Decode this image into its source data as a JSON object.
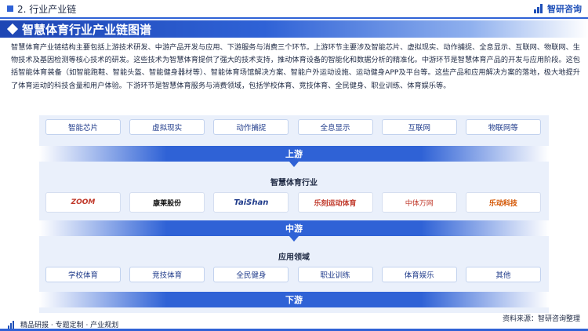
{
  "header": {
    "section_title": "2. 行业产业链",
    "brand_name": "智研咨询"
  },
  "banner": {
    "title": "智慧体育行业产业链图谱"
  },
  "intro": {
    "text": "智慧体育产业链结构主要包括上游技术研发、中游产品开发与应用、下游服务与消费三个环节。上游环节主要涉及智能芯片、虚拟现实、动作捕捉、全息显示、互联网、物联网、生物技术及基因检测等核心技术的研发。这些技术为智慧体育提供了强大的技术支持，推动体育设备的智能化和数据分析的精准化。中游环节是智慧体育产品的开发与应用阶段。这包括智能体育装备（如智能跑鞋、智能头盔、智能健身器材等）、智能体育场馆解决方案、智能户外运动设施、运动健身APP及平台等。这些产品和应用解决方案的落地，极大地提升了体育运动的科技含量和用户体验。下游环节是智慧体育服务与消费领域，包括学校体育、竞技体育、全民健身、职业训练、体育娱乐等。"
  },
  "upstream": {
    "items": [
      "智能芯片",
      "虚拟现实",
      "动作捕捉",
      "全息显示",
      "互联网",
      "物联网等"
    ],
    "bar_label": "上游"
  },
  "midstream": {
    "heading": "智慧体育行业",
    "logos": [
      {
        "name": "ZOOM",
        "color": "#c0392b"
      },
      {
        "name": "康莱股份",
        "color": "#111111"
      },
      {
        "name": "TaiShan",
        "color": "#1e3a8a"
      },
      {
        "name": "乐刻运动体育",
        "color": "#c0392b"
      },
      {
        "name": "中体万网",
        "color": "#c0392b"
      },
      {
        "name": "乐动科技",
        "color": "#d35400"
      }
    ],
    "bar_label": "中游"
  },
  "downstream": {
    "heading": "应用领域",
    "items": [
      "学校体育",
      "竞技体育",
      "全民健身",
      "职业训练",
      "体育娱乐",
      "其他"
    ],
    "bar_label": "下游"
  },
  "footer": {
    "left_text": "精品研报 · 专题定制 · 产业规划",
    "source": "资料来源：智研咨询整理"
  }
}
